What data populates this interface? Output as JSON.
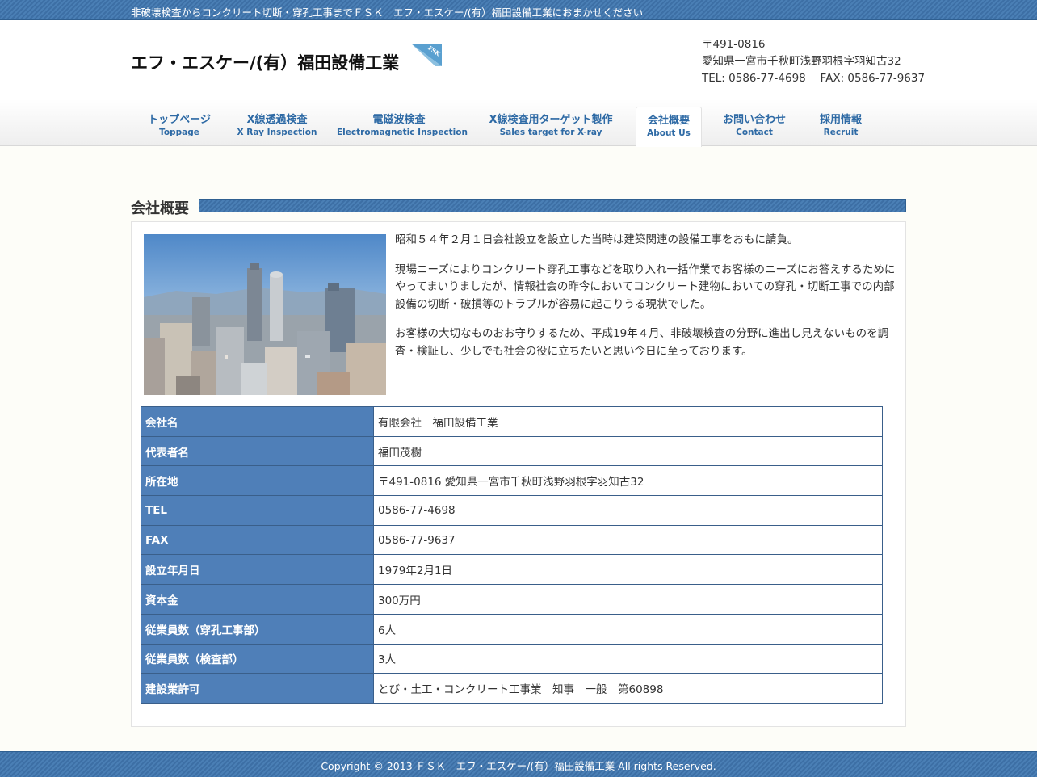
{
  "topbar": {
    "tagline": "非破壊検査からコンクリート切断・穿孔工事までＦＳＫ　エフ・エスケー/(有）福田設備工業におまかせください"
  },
  "header": {
    "site_title": "エフ・エスケー/(有）福田設備工業",
    "logo_text": "FSK",
    "postal": "〒491-0816",
    "address": "愛知県一宮市千秋町浅野羽根字羽知古32",
    "tel_fax": "TEL: 0586-77-4698　 FAX: 0586-77-9637"
  },
  "nav": {
    "items": [
      {
        "jp": "トップページ",
        "en": "Toppage"
      },
      {
        "jp": "X線透過検査",
        "en": "X Ray Inspection"
      },
      {
        "jp": "電磁波検査",
        "en": "Electromagnetic Inspection"
      },
      {
        "jp": "X線検査用ターゲット製作",
        "en": "Sales target for X-ray"
      },
      {
        "jp": "会社概要",
        "en": "About Us"
      },
      {
        "jp": "お問い合わせ",
        "en": "Contact"
      },
      {
        "jp": "採用情報",
        "en": "Recruit"
      }
    ],
    "active_index": 4
  },
  "main": {
    "heading": "会社概要",
    "paragraphs": [
      "昭和５４年２月１日会社設立を設立した当時は建築関連の設備工事をおもに請負。",
      "現場ニーズによりコンクリート穿孔工事などを取り入れ一括作業でお客様のニーズにお答えするためにやってまいりましたが、情報社会の昨今においてコンクリート建物においての穿孔・切断工事での内部設備の切断・破損等のトラブルが容易に起こりうる現状でした。",
      "お客様の大切なものおお守りするため、平成19年４月、非破壊検査の分野に進出し見えないものを調査・検証し、少しでも社会の役に立ちたいと思い今日に至っております。"
    ],
    "table": [
      {
        "label": "会社名",
        "value": "有限会社　福田設備工業"
      },
      {
        "label": "代表者名",
        "value": "福田茂樹"
      },
      {
        "label": "所在地",
        "value": "〒491-0816 愛知県一宮市千秋町浅野羽根字羽知古32"
      },
      {
        "label": "TEL",
        "value": "0586-77-4698"
      },
      {
        "label": "FAX",
        "value": "0586-77-9637"
      },
      {
        "label": "設立年月日",
        "value": "1979年2月1日"
      },
      {
        "label": "資本金",
        "value": "300万円"
      },
      {
        "label": "従業員数（穿孔工事部）",
        "value": "6人"
      },
      {
        "label": "従業員数（検査部）",
        "value": "3人"
      },
      {
        "label": "建設業許可",
        "value": "とび・土工・コンクリート工事業　知事　一般　第60898"
      }
    ]
  },
  "footer": {
    "copyright": "Copyright © 2013 ＦＳＫ　エフ・エスケー/(有）福田設備工業 All rights Reserved."
  },
  "colors": {
    "accent_blue": "#4a7fb5",
    "nav_text": "#2e6aa5",
    "table_header": "#4f7fb8",
    "background": "#fdfdf8"
  }
}
